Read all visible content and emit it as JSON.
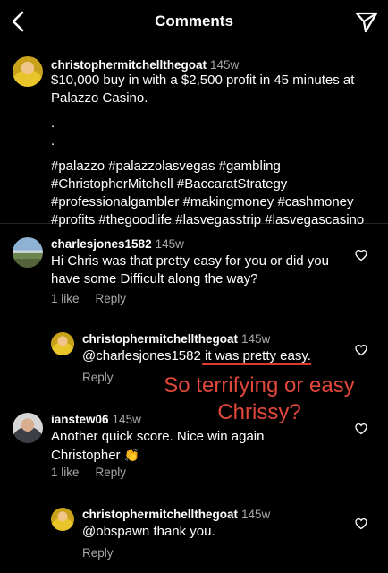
{
  "header": {
    "title": "Comments"
  },
  "caption": {
    "username": "christophermitchellthegoat",
    "time": "145w",
    "line1": "$10,000 buy in with a $2,500 profit in 45 minutes at",
    "line2": "Palazzo Casino.",
    "dot1": ".",
    "dot2": ".",
    "tags1": "#palazzo #palazzolasvegas #gambling",
    "tags2": "#ChristopherMitchell #BaccaratStrategy",
    "tags3": "#professionalgambler #makingmoney #cashmoney",
    "tags4": "#profits #thegoodlife #lasvegasstrip #lasvegascasino"
  },
  "comments": [
    {
      "username": "charlesjones1582",
      "time": "145w",
      "line1": "Hi Chris was that pretty easy for you or did you",
      "line2": "have some Difficult along the way?",
      "likes": "1 like",
      "reply": "Reply"
    },
    {
      "username": "christophermitchellthegoat",
      "time": "145w",
      "mention": "@charlesjones1582 ",
      "body": "it was pretty easy",
      "period": ".",
      "reply": "Reply"
    },
    {
      "username": "ianstew06",
      "time": "145w",
      "line1": "Another quick score.  Nice win again",
      "line2": "Christopher",
      "emoji": "👏",
      "likes": "1 like",
      "reply": "Reply"
    },
    {
      "username": "christophermitchellthegoat",
      "time": "145w",
      "line1": "@obspawn thank you.",
      "reply": "Reply"
    }
  ],
  "annotation": {
    "line1": "So terrifying or easy",
    "line2": "Chrissy?",
    "color": "#e2473c"
  },
  "icons": {
    "back": "chevron-left-icon",
    "share": "paper-plane-icon",
    "like": "heart-icon"
  }
}
